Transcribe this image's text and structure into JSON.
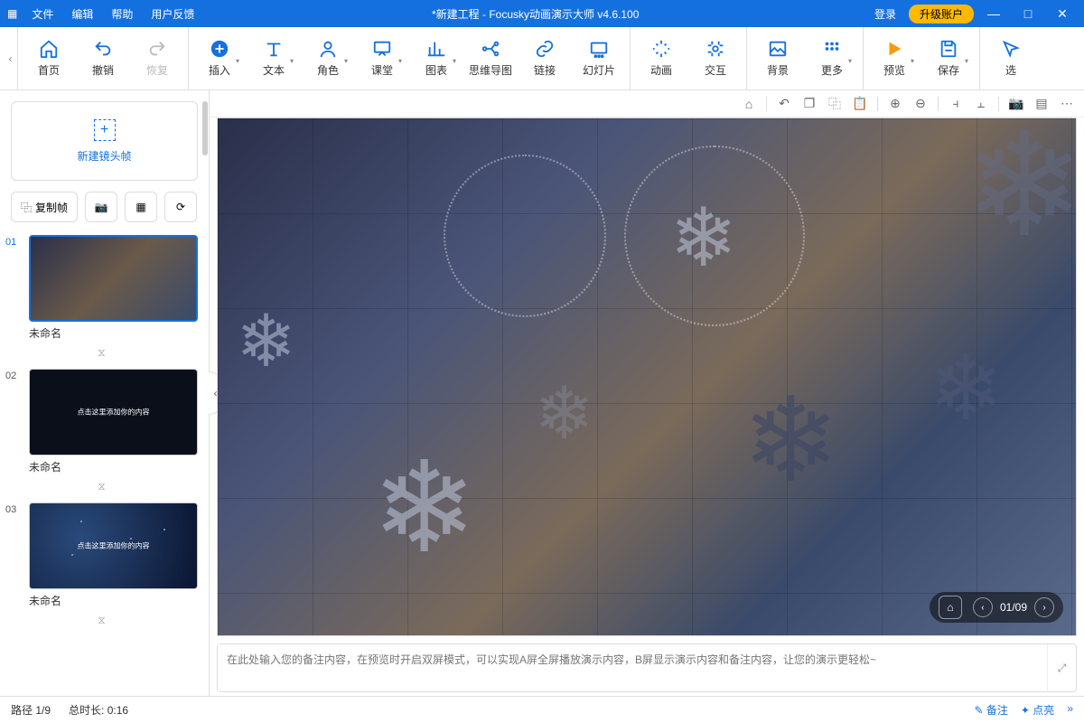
{
  "menu": {
    "file": "文件",
    "edit": "编辑",
    "help": "帮助",
    "feedback": "用户反馈"
  },
  "title": "*新建工程 - Focusky动画演示大师  v4.6.100",
  "login": "登录",
  "upgrade": "升级账户",
  "tools": {
    "home": "首页",
    "undo": "撤销",
    "redo": "恢复",
    "insert": "插入",
    "text": "文本",
    "role": "角色",
    "class": "课堂",
    "chart": "图表",
    "mindmap": "思维导图",
    "link": "链接",
    "slide": "幻灯片",
    "animation": "动画",
    "interact": "交互",
    "background": "背景",
    "more": "更多",
    "preview": "预览",
    "save": "保存",
    "select": "选"
  },
  "sidebar": {
    "new_frame": "新建镜头帧",
    "copy_frame": "复制帧",
    "slides": [
      {
        "num": "01",
        "name": "未命名"
      },
      {
        "num": "02",
        "name": "未命名",
        "text": "点击这里添加你的内容"
      },
      {
        "num": "03",
        "name": "未命名",
        "text": "点击这里添加你的内容"
      }
    ]
  },
  "page_indicator": "01/09",
  "notes_placeholder": "在此处输入您的备注内容，在预览时开启双屏模式，可以实现A屏全屏播放演示内容，B屏显示演示内容和备注内容，让您的演示更轻松~",
  "status": {
    "path": "路径 1/9",
    "duration": "总时长: 0:16",
    "remark": "备注",
    "likes": "点亮"
  }
}
